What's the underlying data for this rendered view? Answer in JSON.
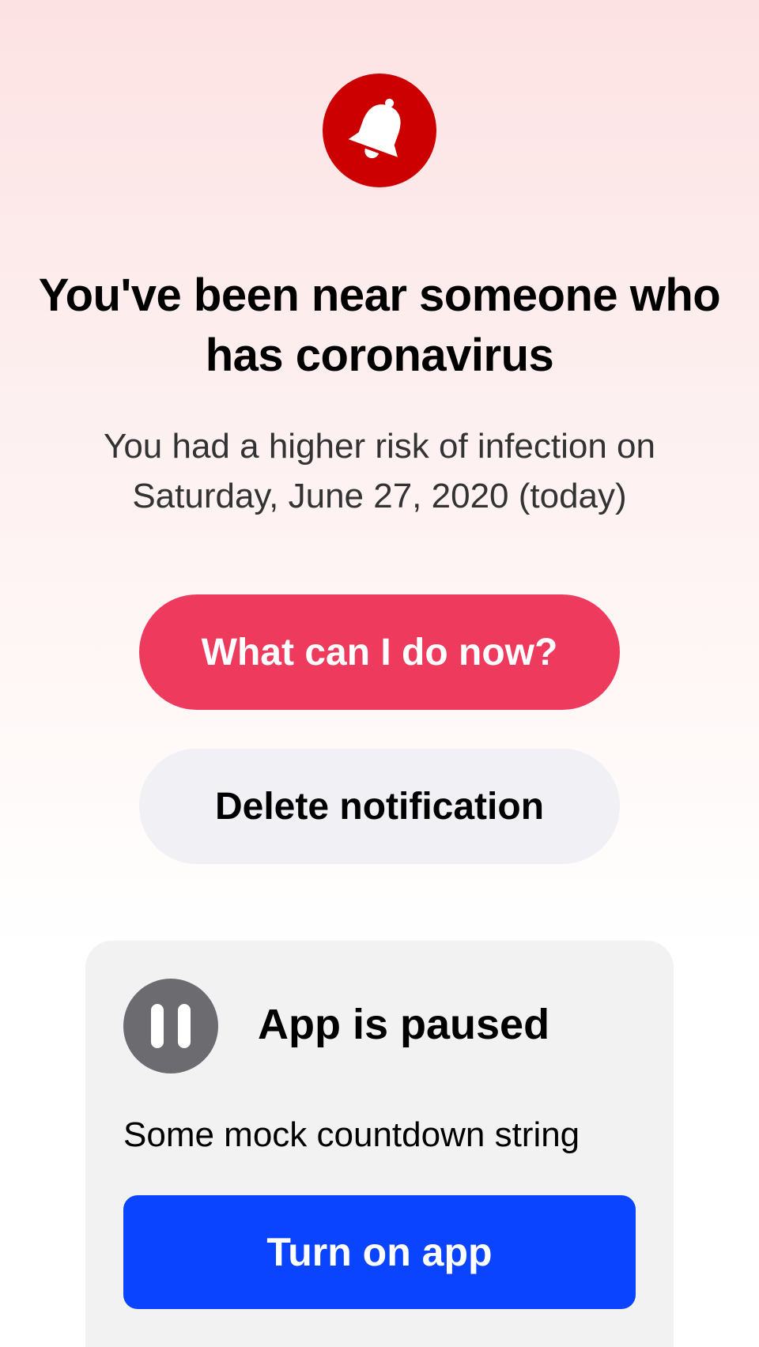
{
  "colors": {
    "alert_red": "#cc0000",
    "primary_button": "#ee3a5c",
    "secondary_button": "#f0f0f5",
    "turn_on_button": "#0a44ff",
    "card_background": "#f2f2f2",
    "pause_icon": "#6b6b70"
  },
  "alert": {
    "icon": "bell-icon",
    "headline": "You've been near someone who has coronavirus",
    "subtext": "You had a higher risk of infection on Saturday, June 27, 2020 (today)"
  },
  "actions": {
    "primary_label": "What can I do now?",
    "secondary_label": "Delete notification"
  },
  "paused_card": {
    "icon": "pause-icon",
    "title": "App is paused",
    "countdown": "Some mock countdown string",
    "button_label": "Turn on app"
  }
}
